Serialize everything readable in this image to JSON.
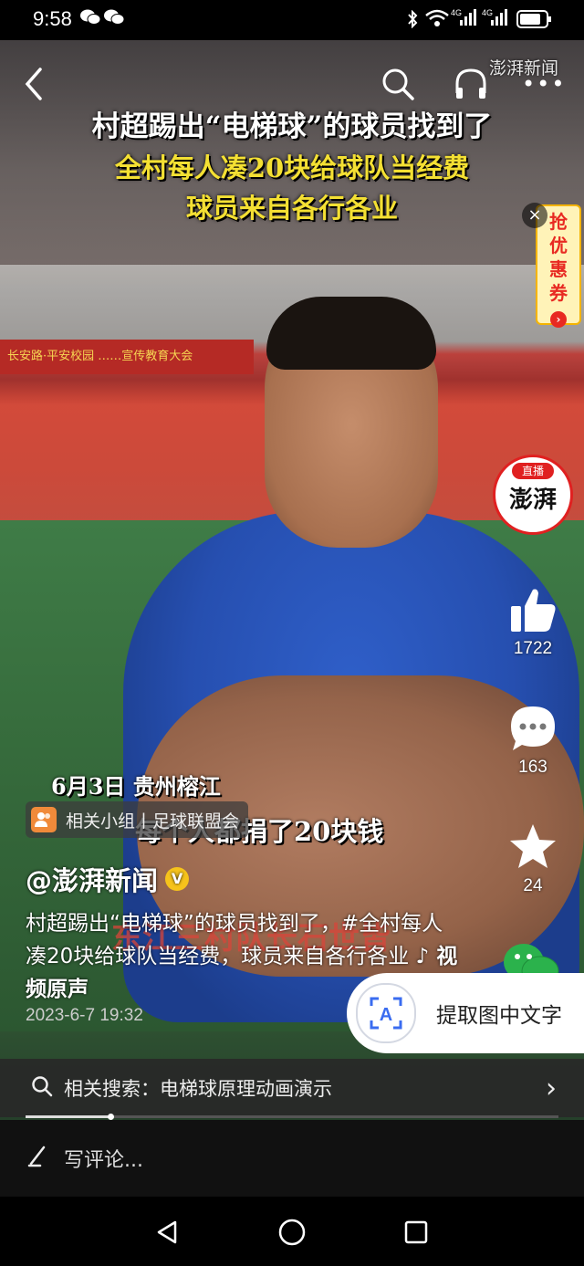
{
  "status_bar": {
    "time": "9:58",
    "network": "46 46",
    "wechat_icons": [
      "wechat-icon",
      "wechat-icon"
    ]
  },
  "top_bar": {
    "back_icon": "back-arrow-icon",
    "search_icon": "search-icon",
    "listen_icon": "headphones-icon",
    "more_icon": "more-icon",
    "watermark": "澎湃新闻"
  },
  "title_overlay": {
    "line1": "村超踢出“电梯球”的球员找到了",
    "line2": "全村每人凑20块给球队当经费",
    "line3": "球员来自各行各业"
  },
  "background_sign": "长安路·平安校园 ……宣传教育大会",
  "coupon": {
    "label": "抢优惠券",
    "close": "×",
    "arrow": "›"
  },
  "live_badge": {
    "tag": "直播",
    "logo": "澎湃"
  },
  "actions": {
    "like": {
      "icon": "thumbs-up-icon",
      "count": "1722"
    },
    "comment": {
      "icon": "comment-icon",
      "count": "163"
    },
    "favorite": {
      "icon": "star-icon",
      "count": "24"
    },
    "share": {
      "icon": "wechat-share-icon"
    }
  },
  "captions": {
    "date_place": "6月3日 贵州榕江",
    "quote": "每个人都捐了20块钱",
    "speaker": "东江三村队长石世皆"
  },
  "group_chip": {
    "icon": "group-icon",
    "label": "相关小组丨足球联盟会"
  },
  "author": {
    "name": "@澎湃新闻",
    "verified": "V"
  },
  "description": {
    "text": "村超踢出“电梯球”的球员找到了，#全村每人凑20块给球队当经费，球员来自各行各业",
    "music": "♪ 视频原声"
  },
  "post_date": "2023-6-7 19:32",
  "ocr_button": {
    "icon": "A",
    "label": "提取图中文字"
  },
  "related_search": {
    "prefix": "相关搜索：",
    "query": "电梯球原理动画演示",
    "chevron": "›"
  },
  "progress": {
    "fraction": 0.16
  },
  "comment_bar": {
    "icon": "pen-icon",
    "placeholder": "写评论..."
  },
  "nav_bar": {
    "back": "back-triangle-icon",
    "home": "home-circle-icon",
    "recents": "recents-square-icon"
  },
  "colors": {
    "accent_yellow": "#f4e033",
    "live_red": "#e02020",
    "coupon_red": "#e82a22",
    "verified_yellow": "#f6c31b",
    "ocr_blue": "#3a6cf0"
  }
}
